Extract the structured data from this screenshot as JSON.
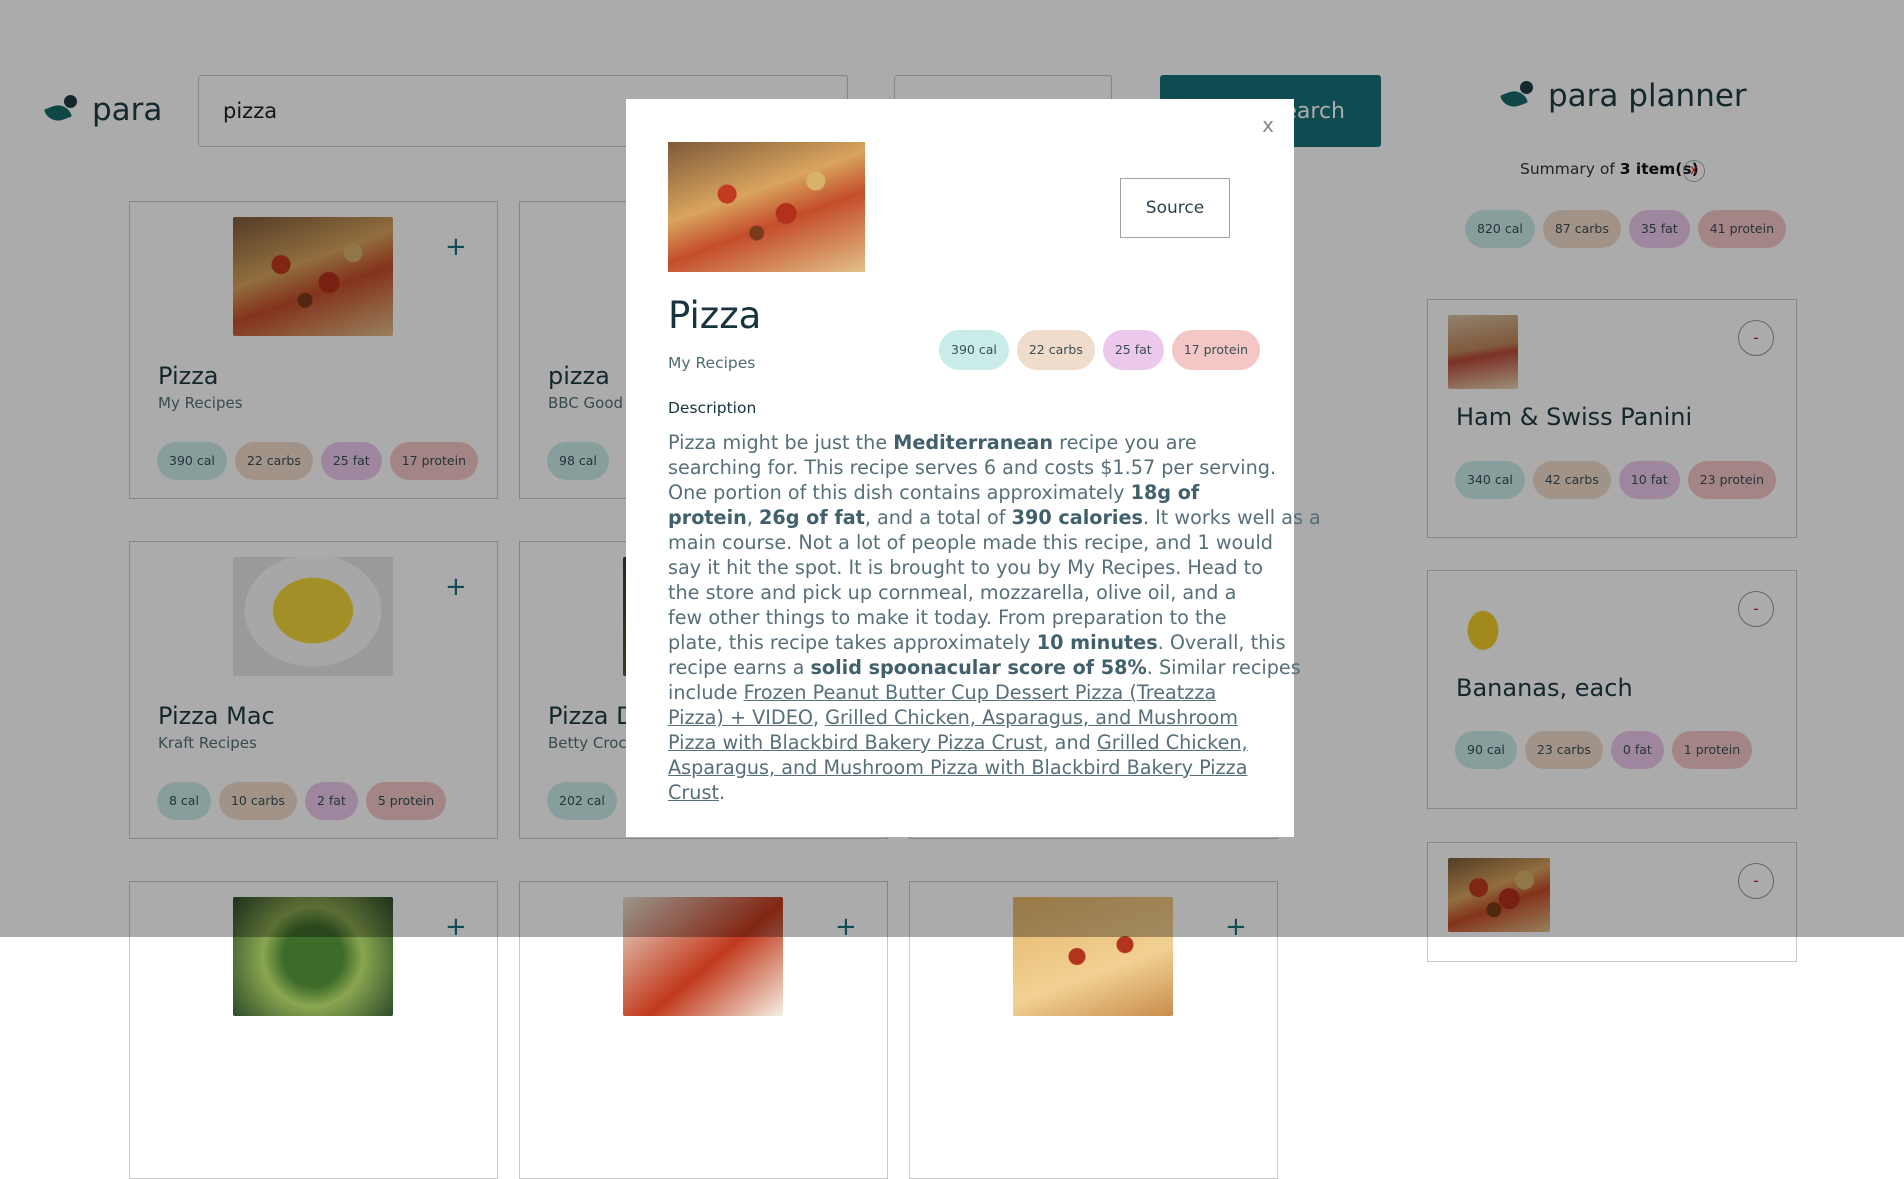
{
  "brand": {
    "name": "para",
    "planner_name": "para planner"
  },
  "search": {
    "value": "pizza",
    "button_label": "Search"
  },
  "results": [
    {
      "title": "Pizza",
      "source": "My Recipes",
      "cal": "390 cal",
      "carbs": "22 carbs",
      "fat": "25 fat",
      "protein": "17 protein"
    },
    {
      "title": "pizza",
      "source": "BBC Good",
      "cal": "98 cal"
    },
    {
      "title": "Pizza Mac",
      "source": "Kraft Recipes",
      "cal": "8 cal",
      "carbs": "10 carbs",
      "fat": "2 fat",
      "protein": "5 protein"
    },
    {
      "title": "Pizza D",
      "source": "Betty Croc",
      "cal": "202 cal"
    }
  ],
  "planner": {
    "summary_prefix": "Summary of",
    "summary_count": "3 item(s)",
    "clear_label": "x",
    "totals": {
      "cal": "820 cal",
      "carbs": "87 carbs",
      "fat": "35 fat",
      "protein": "41 protein"
    },
    "remove_label": "-",
    "items": [
      {
        "title": "Ham & Swiss Panini",
        "cal": "340 cal",
        "carbs": "42 carbs",
        "fat": "10 fat",
        "protein": "23 protein"
      },
      {
        "title": "Bananas, each",
        "cal": "90 cal",
        "carbs": "23 carbs",
        "fat": "0 fat",
        "protein": "1 protein"
      }
    ]
  },
  "add_label": "+",
  "modal": {
    "close_label": "x",
    "source_button": "Source",
    "title": "Pizza",
    "source": "My Recipes",
    "nutrition": {
      "cal": "390 cal",
      "carbs": "22 carbs",
      "fat": "25 fat",
      "protein": "17 protein"
    },
    "description_heading": "Description",
    "description": {
      "l1a": "Pizza might be just the ",
      "l1b": "Mediterranean",
      "l1c": " recipe you are",
      "l2": "searching for. This recipe serves 6 and costs $1.57 per serving.",
      "l3a": "One portion of this dish contains approximately ",
      "l3b": "18g of",
      "l4a": "protein",
      "l4b": ", ",
      "l4c": "26g of fat",
      "l4d": ", and a total of ",
      "l4e": "390 calories",
      "l4f": ". It works well as a",
      "l5": "main course. Not a lot of people made this recipe, and 1 would",
      "l6": "say it hit the spot. It is brought to you by My Recipes. Head to",
      "l7": "the store and pick up cornmeal, mozzarella, olive oil, and a",
      "l8": "few other things to make it today. From preparation to the",
      "l9a": "plate, this recipe takes approximately ",
      "l9b": "10 minutes",
      "l9c": ". Overall, this",
      "l10a": "recipe earns a ",
      "l10b": "solid spoonacular score of 58%",
      "l10c": ". Similar recipes",
      "l11a": "include ",
      "l11b": "Frozen Peanut Butter Cup Dessert Pizza (Treatzza",
      "l12a": "Pizza) + VIDEO",
      "l12b": ", ",
      "l12c": "Grilled Chicken, Asparagus, and Mushroom",
      "l13a": "Pizza with Blackbird Bakery Pizza Crust",
      "l13b": ", and ",
      "l13c": "Grilled Chicken,",
      "l14": "Asparagus, and Mushroom Pizza with Blackbird Bakery Pizza",
      "l15a": "Crust",
      "l15b": "."
    }
  }
}
